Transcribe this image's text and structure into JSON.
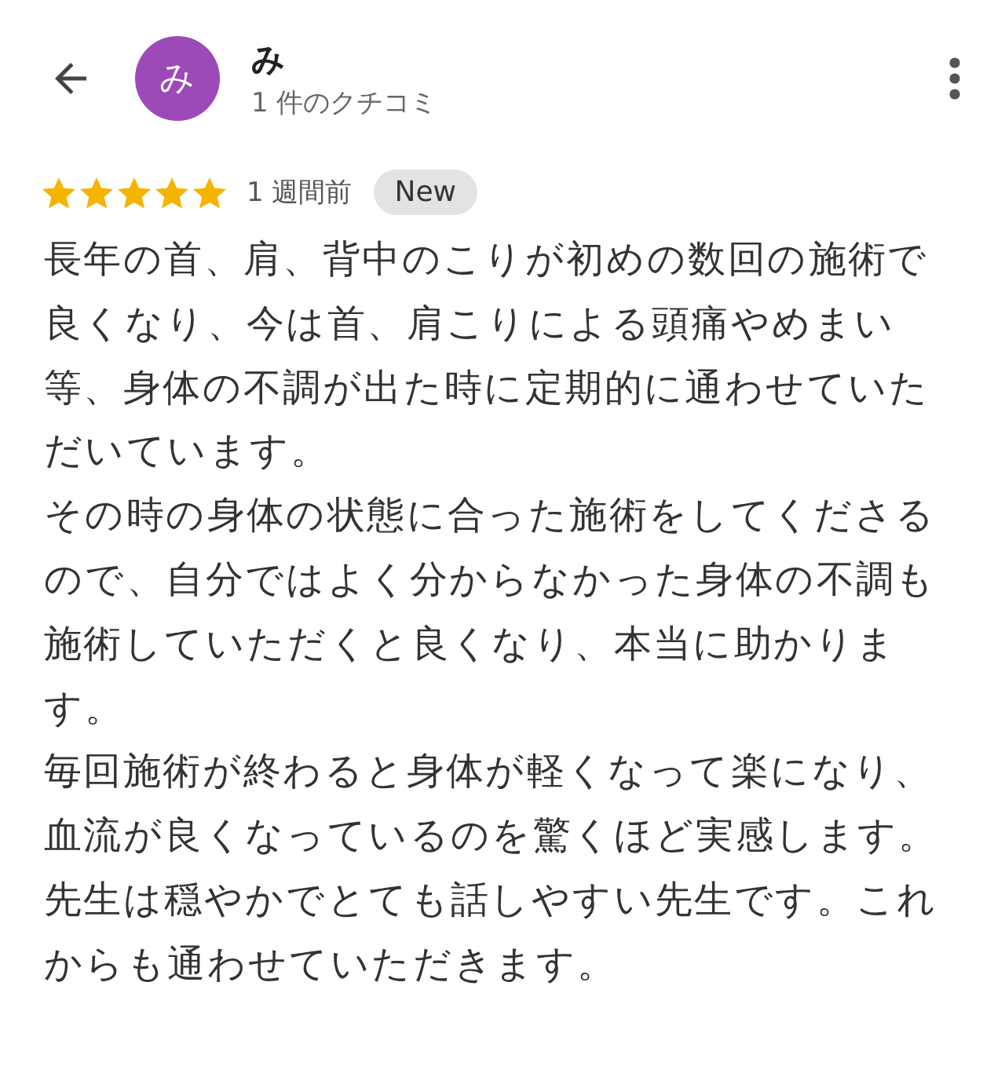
{
  "reviewer": {
    "avatar_letter": "み",
    "name": "み",
    "review_count": "1 件のクチコミ"
  },
  "review": {
    "stars": 5,
    "time": "1 週間前",
    "badge": "New",
    "paragraphs": [
      "長年の首、肩、背中のこりが初めの数回の施術で良くなり、今は首、肩こりによる頭痛やめまい等、身体の不調が出た時に定期的に通わせていただいています。",
      "その時の身体の状態に合った施術をしてくださるので、自分ではよく分からなかった身体の不調も施術していただくと良くなり、本当に助かります。",
      "毎回施術が終わると身体が軽くなって楽になり、血流が良くなっているのを驚くほど実感します。",
      "先生は穏やかでとても話しやすい先生です。これからも通わせていただきます。"
    ]
  }
}
